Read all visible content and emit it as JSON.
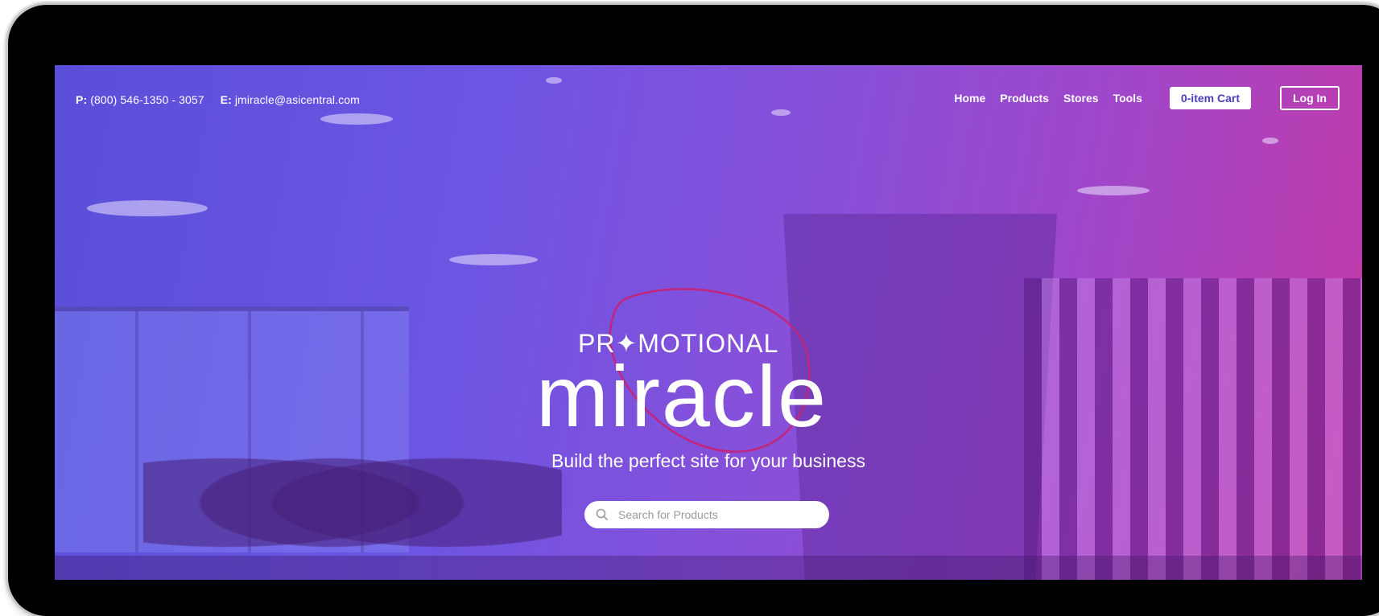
{
  "contact": {
    "phone_label": "P:",
    "phone": "(800) 546-1350 - 3057",
    "email_label": "E:",
    "email": "jmiracle@asicentral.com"
  },
  "nav": {
    "items": [
      {
        "label": "Home"
      },
      {
        "label": "Products"
      },
      {
        "label": "Stores"
      },
      {
        "label": "Tools"
      }
    ],
    "cart_label": "0-item Cart",
    "login_label": "Log In"
  },
  "hero": {
    "logo_top": "PR✦MOTIONAL",
    "logo_main": "miracle",
    "tagline": "Build the perfect site for your business",
    "search_placeholder": "Search for Products"
  },
  "colors": {
    "gradient_start": "#5a4fd9",
    "gradient_end": "#c43aa6",
    "ring": "#c2267a"
  },
  "icons": {
    "search": "search-icon",
    "logo_star": "sparkle-icon"
  }
}
